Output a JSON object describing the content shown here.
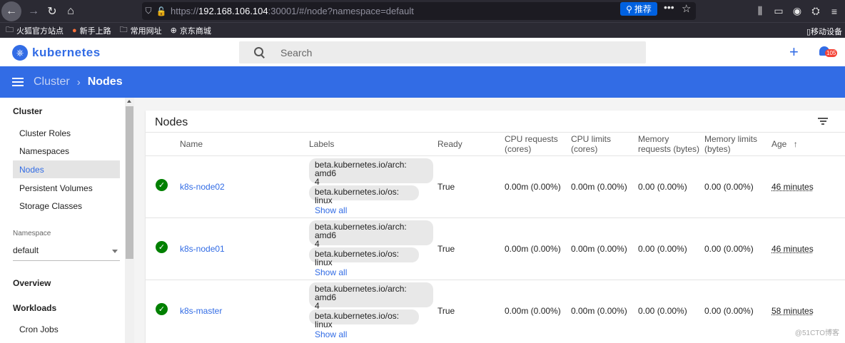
{
  "browser": {
    "url_scheme": "https://",
    "url_host": "192.168.106.104",
    "url_rest": ":30001/#/node?namespace=default",
    "recommend_label": "推荐",
    "bookmarks": [
      "火狐官方站点",
      "新手上路",
      "常用网址",
      "京东商城"
    ],
    "mobile_devices": "移动设备"
  },
  "header": {
    "logo_text": "kubernetes",
    "search_placeholder": "Search",
    "notification_count": "105"
  },
  "titlebar": {
    "parent": "Cluster",
    "current": "Nodes"
  },
  "sidebar": {
    "cluster_heading": "Cluster",
    "items": [
      "Cluster Roles",
      "Namespaces",
      "Nodes",
      "Persistent Volumes",
      "Storage Classes"
    ],
    "active_item": "Nodes",
    "namespace_label": "Namespace",
    "namespace_value": "default",
    "overview": "Overview",
    "workloads": "Workloads",
    "cron_jobs": "Cron Jobs"
  },
  "table": {
    "title": "Nodes",
    "columns": {
      "name": "Name",
      "labels": "Labels",
      "ready": "Ready",
      "cpu_requests": "CPU requests",
      "cpu_requests_unit": "(cores)",
      "cpu_limits": "CPU limits",
      "cpu_limits_unit": "(cores)",
      "mem_requests": "Memory",
      "mem_requests_unit": "requests (bytes)",
      "mem_limits": "Memory limits",
      "mem_limits_unit": "(bytes)",
      "age": "Age"
    },
    "rows": [
      {
        "name": "k8s-node02",
        "label_arch_1": "beta.kubernetes.io/arch: amd6",
        "label_arch_2": "4",
        "label_os": "beta.kubernetes.io/os: linux",
        "show_all": "Show all",
        "ready": "True",
        "cpu_requests": "0.00m (0.00%)",
        "cpu_limits": "0.00m (0.00%)",
        "mem_requests": "0.00 (0.00%)",
        "mem_limits": "0.00 (0.00%)",
        "age": "46 minutes"
      },
      {
        "name": "k8s-node01",
        "label_arch_1": "beta.kubernetes.io/arch: amd6",
        "label_arch_2": "4",
        "label_os": "beta.kubernetes.io/os: linux",
        "show_all": "Show all",
        "ready": "True",
        "cpu_requests": "0.00m (0.00%)",
        "cpu_limits": "0.00m (0.00%)",
        "mem_requests": "0.00 (0.00%)",
        "mem_limits": "0.00 (0.00%)",
        "age": "46 minutes"
      },
      {
        "name": "k8s-master",
        "label_arch_1": "beta.kubernetes.io/arch: amd6",
        "label_arch_2": "4",
        "label_os": "beta.kubernetes.io/os: linux",
        "show_all": "Show all",
        "ready": "True",
        "cpu_requests": "0.00m (0.00%)",
        "cpu_limits": "0.00m (0.00%)",
        "mem_requests": "0.00 (0.00%)",
        "mem_limits": "0.00 (0.00%)",
        "age": "58 minutes"
      }
    ]
  },
  "watermark": "@51CTO博客",
  "colors": {
    "accent": "#326ce5",
    "ready_green": "#008000",
    "browser_dark": "#2b2a33"
  }
}
